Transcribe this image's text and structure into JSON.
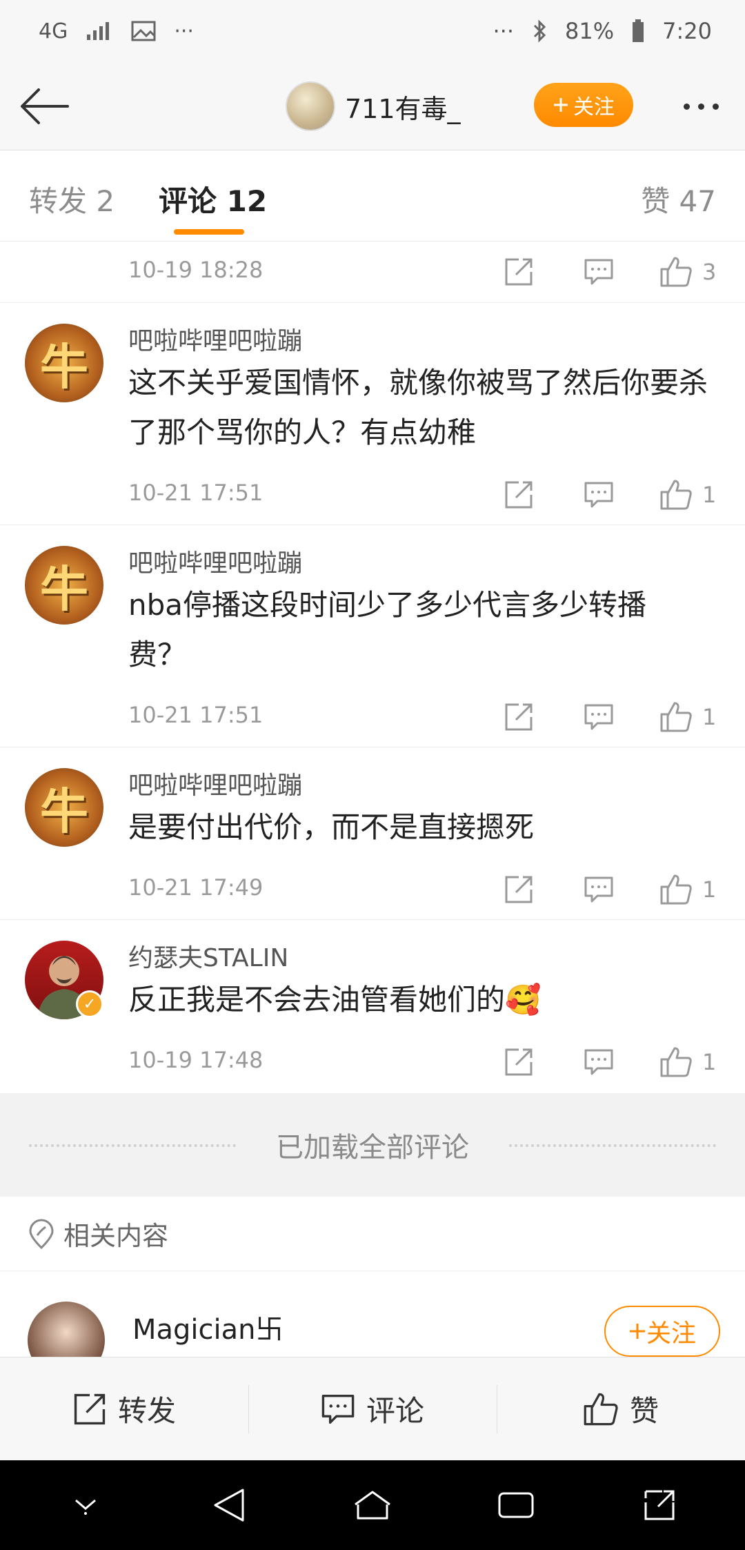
{
  "status": {
    "network": "4G",
    "battery": "81%",
    "time": "7:20",
    "dots": "···"
  },
  "header": {
    "username": "711有毒_",
    "follow_label": "关注"
  },
  "tabs": {
    "repost": "转发 2",
    "comment": "评论 12",
    "like": "赞 47"
  },
  "top_meta": {
    "time": "10-19 18:28",
    "likes": "3"
  },
  "comments": [
    {
      "avatar": "牛",
      "name": "吧啦哔哩吧啦蹦",
      "text": "这不关乎爱国情怀，就像你被骂了然后你要杀了那个骂你的人？有点幼稚",
      "time": "10-21 17:51",
      "likes": "1"
    },
    {
      "avatar": "牛",
      "name": "吧啦哔哩吧啦蹦",
      "text": "nba停播这段时间少了多少代言多少转播费？",
      "time": "10-21 17:51",
      "likes": "1"
    },
    {
      "avatar": "牛",
      "name": "吧啦哔哩吧啦蹦",
      "text": "是要付出代价，而不是直接摁死",
      "time": "10-21 17:49",
      "likes": "1"
    },
    {
      "avatar": "",
      "name": "约瑟夫STALIN",
      "text": "反正我是不会去油管看她们的🥰",
      "time": "10-19 17:48",
      "likes": "1"
    }
  ],
  "loaded_text": "已加载全部评论",
  "related": {
    "title": "相关内容",
    "user_name": "Magician卐",
    "follow_label": "关注"
  },
  "action_bar": {
    "repost": "转发",
    "comment": "评论",
    "like": "赞"
  },
  "colors": {
    "accent": "#ff8a00"
  }
}
